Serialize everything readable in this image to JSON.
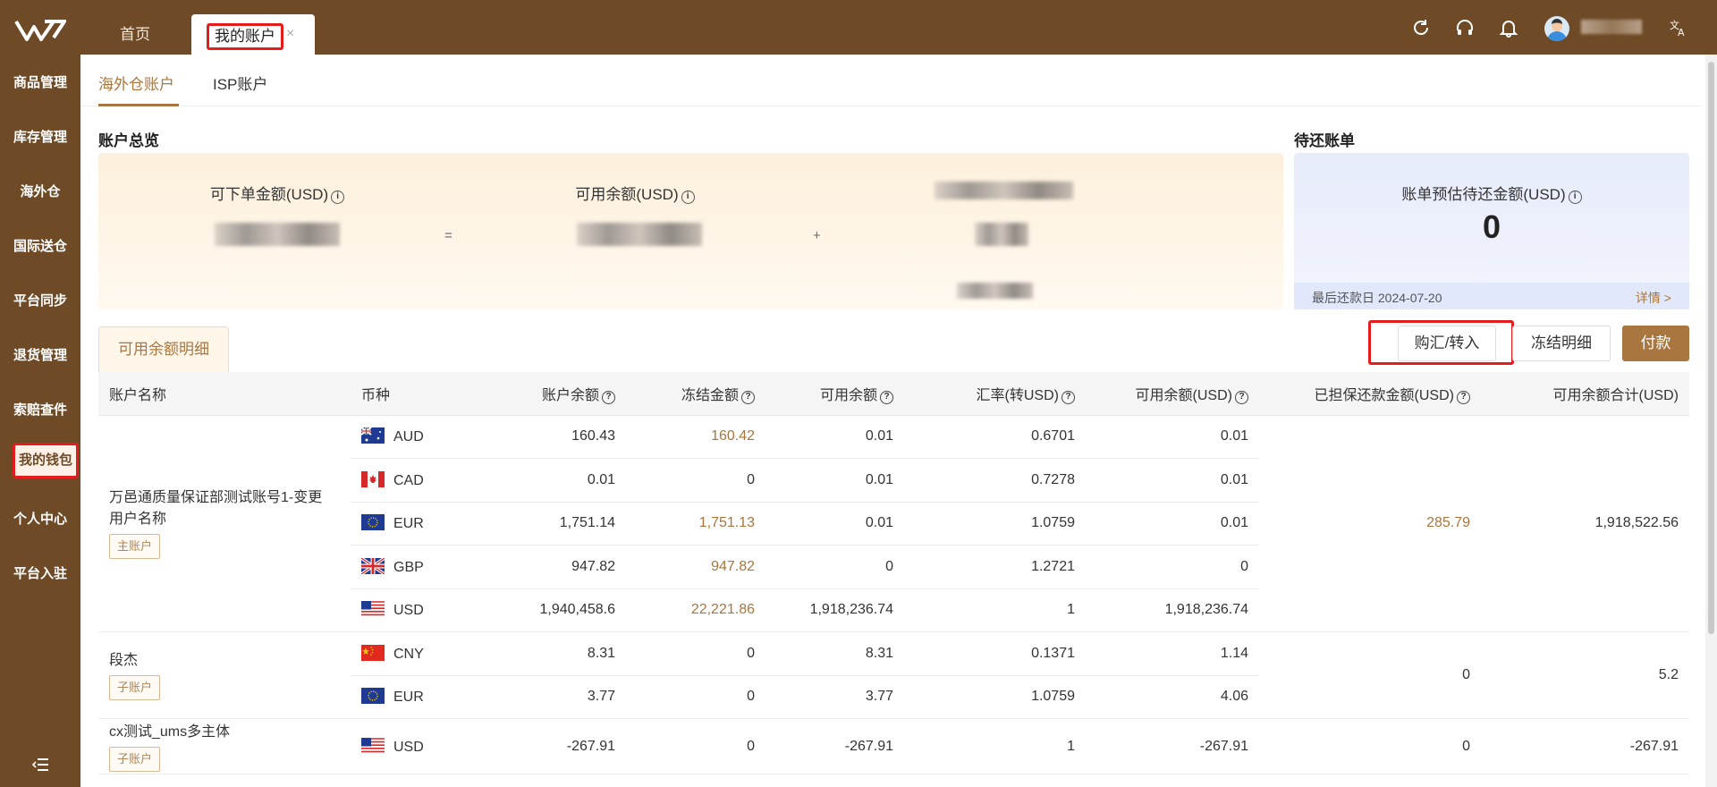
{
  "topbar": {
    "tabs": [
      {
        "label": "首页"
      },
      {
        "label": "我的账户",
        "close": "×"
      }
    ],
    "icons": [
      "refresh-icon",
      "headset-icon",
      "bell-icon",
      "translate-icon"
    ]
  },
  "sidebar": {
    "items": [
      {
        "label": "商品管理"
      },
      {
        "label": "库存管理"
      },
      {
        "label": "海外仓"
      },
      {
        "label": "国际送仓"
      },
      {
        "label": "平台同步"
      },
      {
        "label": "退货管理"
      },
      {
        "label": "索赔查件"
      },
      {
        "label": "我的钱包",
        "active": true
      },
      {
        "label": "个人中心"
      },
      {
        "label": "平台入驻"
      }
    ],
    "collapse_icon": "menu-collapse-icon"
  },
  "subtabs": [
    {
      "label": "海外仓账户",
      "active": true
    },
    {
      "label": "ISP账户"
    }
  ],
  "overview": {
    "title": "账户总览",
    "orderable_label": "可下单金额(USD)",
    "available_label": "可用余额(USD)",
    "eq": "=",
    "plus": "+"
  },
  "bill": {
    "title": "待还账单",
    "label": "账单预估待还金额(USD)",
    "amount": "0",
    "due_date": "最后还款日 2024-07-20",
    "detail": "详情 >"
  },
  "detail_tab": "可用余额明细",
  "buttons": {
    "exchange": "购汇/转入",
    "frozen": "冻结明细",
    "pay": "付款"
  },
  "table": {
    "headers": [
      "账户名称",
      "币种",
      "账户余额",
      "冻结金额",
      "可用余额",
      "汇率(转USD)",
      "可用余额(USD)",
      "已担保还款金额(USD)",
      "可用余额合计(USD)"
    ],
    "groups": [
      {
        "name": "万邑通质量保证部测试账号1-变更用户名称",
        "tag": "主账户",
        "guaranteed": "285.79",
        "total": "1,918,522.56",
        "rows": [
          {
            "currency": "AUD",
            "flag": "au",
            "balance": "160.43",
            "frozen": "160.42",
            "available": "0.01",
            "rate": "0.6701",
            "available_usd": "0.01"
          },
          {
            "currency": "CAD",
            "flag": "ca",
            "balance": "0.01",
            "frozen": "0",
            "available": "0.01",
            "rate": "0.7278",
            "available_usd": "0.01"
          },
          {
            "currency": "EUR",
            "flag": "eu",
            "balance": "1,751.14",
            "frozen": "1,751.13",
            "available": "0.01",
            "rate": "1.0759",
            "available_usd": "0.01"
          },
          {
            "currency": "GBP",
            "flag": "gb",
            "balance": "947.82",
            "frozen": "947.82",
            "available": "0",
            "rate": "1.2721",
            "available_usd": "0"
          },
          {
            "currency": "USD",
            "flag": "us",
            "balance": "1,940,458.6",
            "frozen": "22,221.86",
            "available": "1,918,236.74",
            "rate": "1",
            "available_usd": "1,918,236.74"
          }
        ]
      },
      {
        "name": "段杰",
        "tag": "子账户",
        "guaranteed": "0",
        "total": "5.2",
        "rows": [
          {
            "currency": "CNY",
            "flag": "cn",
            "balance": "8.31",
            "frozen": "0",
            "available": "8.31",
            "rate": "0.1371",
            "available_usd": "1.14"
          },
          {
            "currency": "EUR",
            "flag": "eu",
            "balance": "3.77",
            "frozen": "0",
            "available": "3.77",
            "rate": "1.0759",
            "available_usd": "4.06"
          }
        ]
      },
      {
        "name": "cx测试_ums多主体",
        "tag": "子账户",
        "guaranteed": "0",
        "total": "-267.91",
        "rows": [
          {
            "currency": "USD",
            "flag": "us",
            "balance": "-267.91",
            "frozen": "0",
            "available": "-267.91",
            "rate": "1",
            "available_usd": "-267.91"
          }
        ]
      }
    ]
  },
  "colors": {
    "brand": "#6e4a26",
    "accent": "#a8763e",
    "highlight": "#e51c1c"
  }
}
